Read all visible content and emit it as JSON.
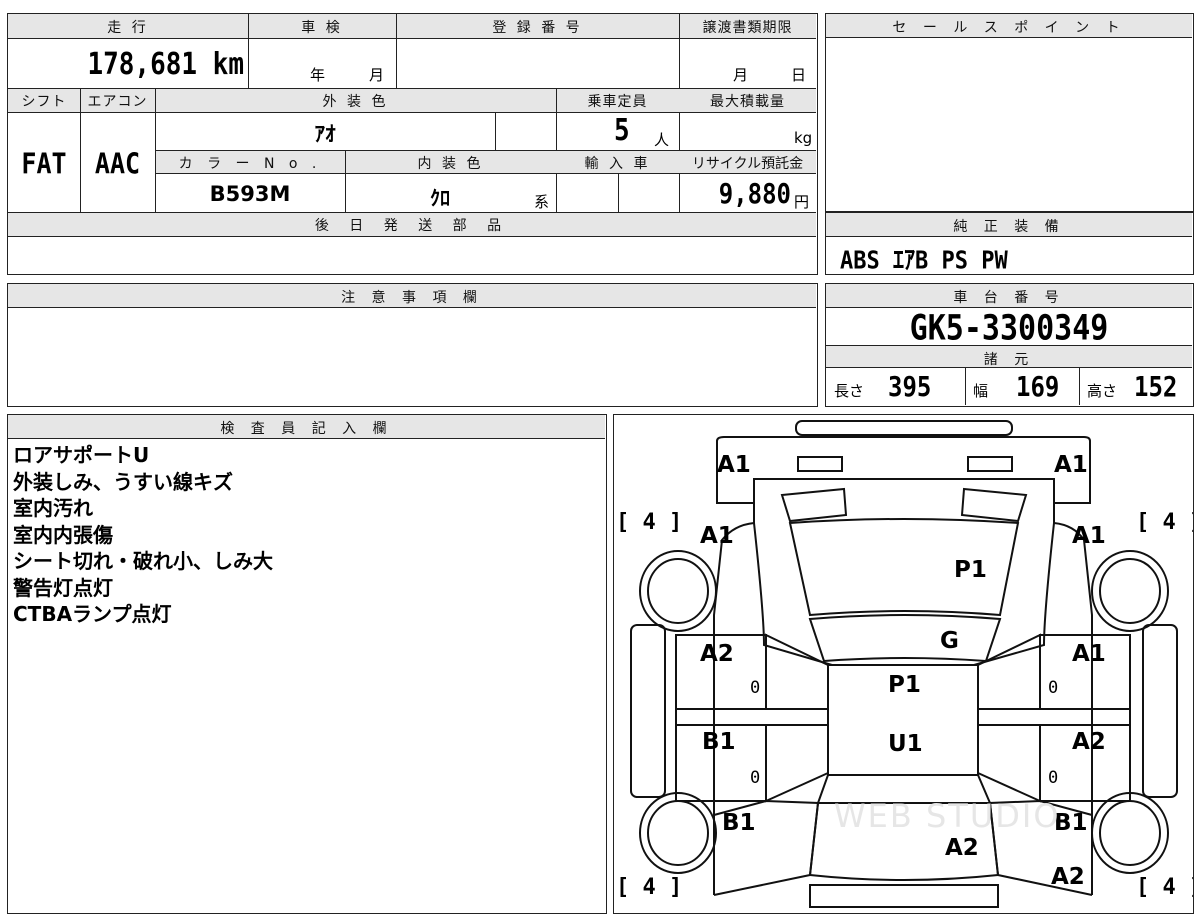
{
  "top_sheet": {
    "headers": {
      "mileage": "走 行",
      "inspection": "車 検",
      "registration": "登 録 番 号",
      "transfer_deadline": "譲渡書類期限",
      "shift": "シフト",
      "aircon": "エアコン",
      "exterior_color": "外 装 色",
      "capacity": "乗車定員",
      "max_load": "最大積載量",
      "color_no": "カ ラ ー N o .",
      "interior_color": "内 装 色",
      "import": "輸 入 車",
      "recycle": "リサイクル預託金",
      "parts_later": "後 日 発 送 部 品"
    },
    "values": {
      "mileage": "178,681 km",
      "inspection_year": "年",
      "inspection_month": "月",
      "transfer_month": "月",
      "transfer_day": "日",
      "shift": "FAT",
      "aircon": "AAC",
      "exterior_color": "ｱｵ",
      "capacity_num": "5",
      "capacity_unit": "人",
      "max_load_unit": "kg",
      "color_no": "B593M",
      "interior_color": "ｸﾛ",
      "interior_suffix": "系",
      "recycle_amount": "9,880",
      "recycle_unit": "円"
    }
  },
  "sales_point": {
    "header": "セ ー ル ス ポ イ ン ト"
  },
  "standard_equipment": {
    "header": "純 正 装 備",
    "value": "ABS ｴｱB PS PW"
  },
  "notes": {
    "header": "注 意 事 項 欄"
  },
  "chassis": {
    "header": "車 台 番 号",
    "number": "GK5-3300349",
    "specs_header": "諸 元",
    "length_label": "長さ",
    "length": "395",
    "width_label": "幅",
    "width": "169",
    "height_label": "高さ",
    "height": "152"
  },
  "inspector": {
    "header": "検 査 員 記 入 欄",
    "lines": [
      "ロアサポートU",
      "外装しみ、うすい線キズ",
      "室内汚れ",
      "室内内張傷",
      "シート切れ・破れ小、しみ大",
      "警告灯点灯",
      "CTBAランプ点灯"
    ]
  },
  "diagram": {
    "labels": {
      "front_left": "A1",
      "front_right": "A1",
      "left_front_fender": "A1",
      "right_front_fender": "A1",
      "hood": "P1",
      "windshield": "G",
      "roof": "P1",
      "roof_rear": "U1",
      "left_front_door": "A2",
      "right_front_door": "A1",
      "left_rear_door": "B1",
      "right_rear_door": "A2",
      "left_rear_quarter": "B1",
      "right_rear_quarter": "B1",
      "trunk": "A2",
      "rear_right": "A2"
    },
    "tyre_marks": [
      "[ 4 ]",
      "[ 4 ]",
      "[ 4 ]",
      "[ 4 ]"
    ],
    "door_zeros": [
      "0",
      "0",
      "0",
      "0"
    ],
    "watermark": "WEB STUDIO"
  }
}
